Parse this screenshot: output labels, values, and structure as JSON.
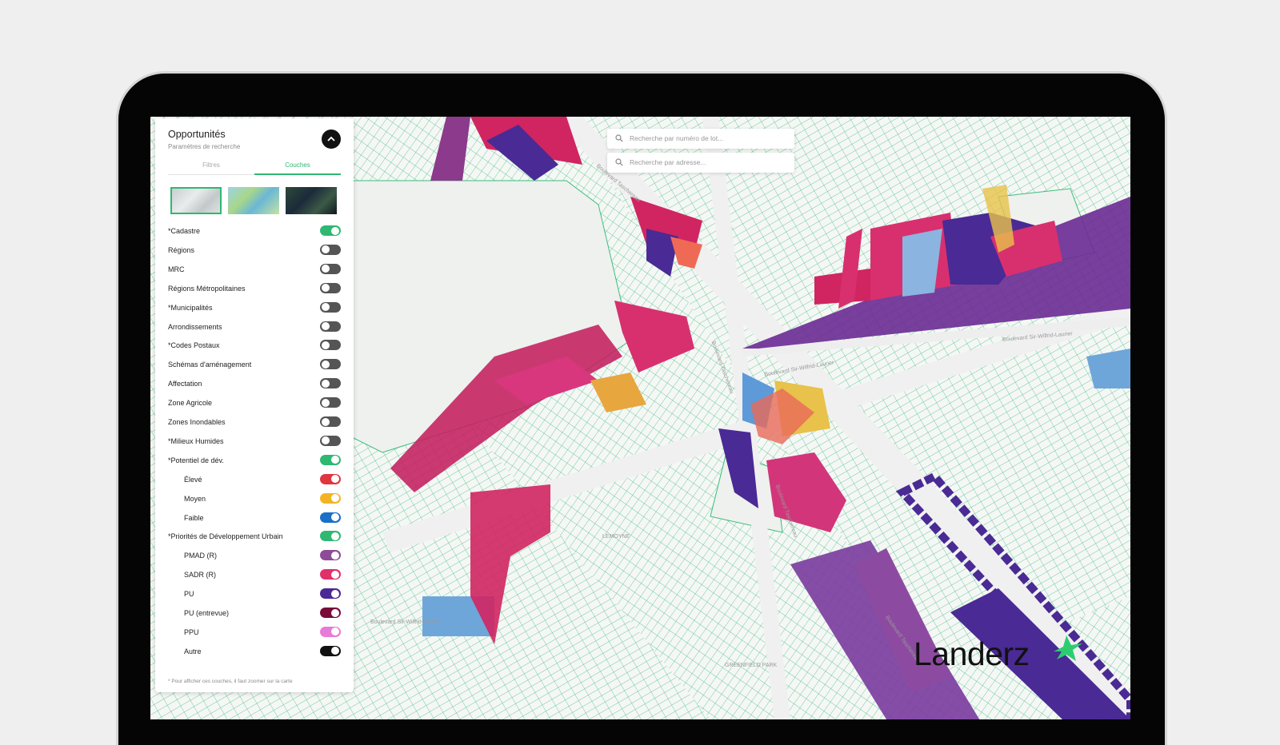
{
  "panel": {
    "title": "Opportunités",
    "subtitle": "Paramètres de recherche",
    "tabs": [
      "Filtres",
      "Couches"
    ],
    "active_tab": "Couches",
    "basemaps": [
      "plan",
      "terrain",
      "satellite"
    ],
    "selected_basemap": "plan",
    "layers": [
      {
        "label": "*Cadastre",
        "on": true,
        "color": "#2eb872",
        "sub": false
      },
      {
        "label": "Régions",
        "on": false,
        "color": "#555555",
        "sub": false
      },
      {
        "label": "MRC",
        "on": false,
        "color": "#555555",
        "sub": false
      },
      {
        "label": "Régions Métropolitaines",
        "on": false,
        "color": "#555555",
        "sub": false
      },
      {
        "label": "*Municipalités",
        "on": false,
        "color": "#555555",
        "sub": false
      },
      {
        "label": "Arrondissements",
        "on": false,
        "color": "#555555",
        "sub": false
      },
      {
        "label": "*Codes Postaux",
        "on": false,
        "color": "#555555",
        "sub": false
      },
      {
        "label": "Schémas d'aménagement",
        "on": false,
        "color": "#555555",
        "sub": false
      },
      {
        "label": "Affectation",
        "on": false,
        "color": "#555555",
        "sub": false
      },
      {
        "label": "Zone Agricole",
        "on": false,
        "color": "#555555",
        "sub": false
      },
      {
        "label": "Zones Inondables",
        "on": false,
        "color": "#555555",
        "sub": false
      },
      {
        "label": "*Milieux Humides",
        "on": false,
        "color": "#555555",
        "sub": false
      },
      {
        "label": "*Potentiel de dév.",
        "on": true,
        "color": "#2eb872",
        "sub": false
      },
      {
        "label": "Élevé",
        "on": true,
        "color": "#e0363f",
        "sub": true
      },
      {
        "label": "Moyen",
        "on": true,
        "color": "#f3b423",
        "sub": true
      },
      {
        "label": "Faible",
        "on": true,
        "color": "#1a6fc8",
        "sub": true
      },
      {
        "label": "*Priorités de Développement Urbain",
        "on": true,
        "color": "#2eb872",
        "sub": false
      },
      {
        "label": "PMAD (R)",
        "on": true,
        "color": "#8e4b97",
        "sub": true
      },
      {
        "label": "SADR (R)",
        "on": true,
        "color": "#e0306a",
        "sub": true
      },
      {
        "label": "PU",
        "on": true,
        "color": "#4a2a94",
        "sub": true
      },
      {
        "label": "PU (entrevue)",
        "on": true,
        "color": "#7a0a3a",
        "sub": true
      },
      {
        "label": "PPU",
        "on": true,
        "color": "#e87ad8",
        "sub": true
      },
      {
        "label": "Autre",
        "on": true,
        "color": "#111111",
        "sub": true
      }
    ],
    "footnote": "* Pour afficher ces couches, il faut zoomer sur la carte"
  },
  "search": {
    "lot_placeholder": "Recherche par numéro de lot...",
    "address_placeholder": "Recherche par adresse..."
  },
  "map": {
    "road_labels": [
      "Boulevard Sir-Wilfrid-Laurier",
      "Boulevard Sir-Wilfrid-Laurier",
      "Boulevard Taschereau",
      "Boulevard Taschereau",
      "Boulevard Sir-Wilfrid-Laurier",
      "LEMOYNE",
      "GREENFIELD PARK",
      "Boulevard Taschereau",
      "Boulevard Taschereau"
    ],
    "colors": {
      "cadastre": "#2eb872",
      "background": "#f3f5f3"
    }
  },
  "brand": {
    "logo_text": "Landerz",
    "accent": "#2ecc71"
  },
  "icons": {
    "collapse": "chevron-up-icon",
    "search": "search-icon",
    "logo_mark": "leaf-star-icon"
  }
}
